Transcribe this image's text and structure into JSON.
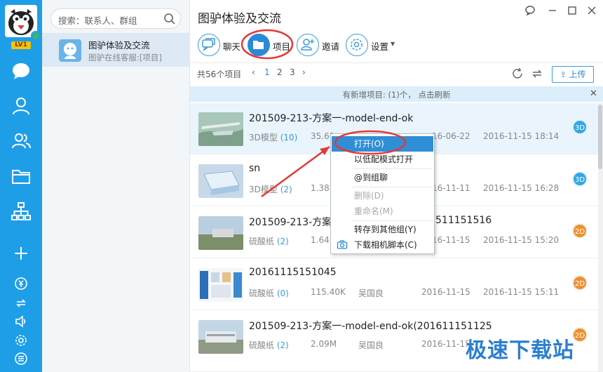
{
  "rail": {
    "level": "LV1"
  },
  "sidebar": {
    "search_placeholder": "搜索：联系人、群组",
    "group": {
      "name": "图驴体验及交流",
      "subtitle": "图驴在线客服:[项目]"
    }
  },
  "header": {
    "title": "图驴体验及交流"
  },
  "toolbar": {
    "chat": "聊天",
    "project": "项目",
    "invite": "邀请",
    "settings": "设置"
  },
  "listbar": {
    "count": "共56个项目",
    "prev": "‹",
    "pages": [
      "1",
      "2",
      "3"
    ],
    "next": "›",
    "upload": "上传"
  },
  "notice": {
    "text": "有新增项目: (1)个， 点击刷新",
    "close": "✕"
  },
  "rows": [
    {
      "name": "201509-213-方案一-model-end-ok",
      "type": "3D模型",
      "count": "(10)",
      "size": "35.61",
      "owner": "",
      "created": "16-06-22",
      "updated": "2016-11-15 18:14",
      "badge": "3D"
    },
    {
      "name": "sn",
      "type": "3D模型",
      "count": "(2)",
      "size": "1.38M",
      "owner": "",
      "created": "16-11-11",
      "updated": "2016-11-15 16:28",
      "badge": "3D"
    },
    {
      "name": "201509-213-方案一",
      "name_tail": "511151516",
      "type": "硫酸纸",
      "count": "(2)",
      "size": "1.64M",
      "owner": "",
      "created": "16-11-15",
      "updated": "2016-11-15 15:20",
      "badge": "2D"
    },
    {
      "name": "20161115151045",
      "type": "硫酸纸",
      "count": "(0)",
      "size": "115.40K",
      "owner": "吴国良",
      "created": "2016-11-15",
      "updated": "2016-11-15 15:11",
      "badge": "2D"
    },
    {
      "name": "201509-213-方案一-model-end-ok(201611151125",
      "type": "硫酸纸",
      "count": "(2)",
      "size": "2.09M",
      "owner": "吴国良",
      "created": "2016-11-15",
      "updated": "",
      "badge": "2D"
    }
  ],
  "menu": {
    "open": "打开(O)",
    "open_low": "以低配模式打开",
    "at_group": "@到组聊",
    "delete": "删除(D)",
    "rename": "重命名(M)",
    "save_other": "转存到其他组(Y)",
    "download_script": "下载相机脚本(C)"
  },
  "watermark": "极速下载站",
  "colors": {
    "accent": "#1f9ee8",
    "badge3d": "#2ea8e6",
    "badge2d": "#f0902a",
    "highlight": "#2f8ed6",
    "annotation": "#e53935"
  }
}
